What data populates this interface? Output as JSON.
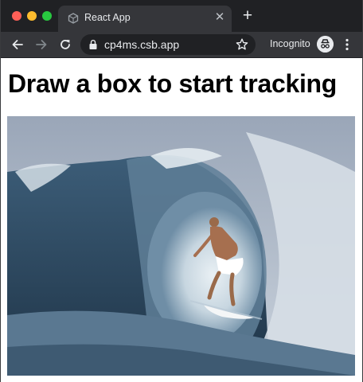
{
  "browser": {
    "tab": {
      "title": "React App",
      "favicon": "codesandbox-cube-icon"
    },
    "new_tab_icon": "plus-icon",
    "address_bar": {
      "url": "cp4ms.csb.app",
      "secure_icon": "lock-icon"
    },
    "profile": {
      "label": "Incognito",
      "icon": "incognito-icon"
    },
    "colors": {
      "tabstrip": "#202124",
      "toolbar": "#35363a",
      "close": "#ff5f57",
      "minimize": "#febc2e",
      "maximize": "#28c840"
    }
  },
  "page": {
    "heading": "Draw a box to start tracking",
    "video": {
      "subject": "surfer riding inside a breaking wave barrel"
    }
  }
}
